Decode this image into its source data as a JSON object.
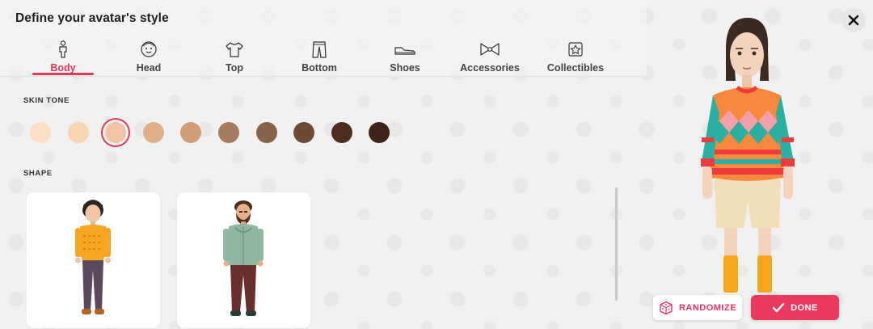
{
  "title": "Define your avatar's style",
  "tabs": [
    {
      "label": "Body",
      "icon": "body-icon",
      "active": true
    },
    {
      "label": "Head",
      "icon": "head-icon",
      "active": false
    },
    {
      "label": "Top",
      "icon": "shirt-icon",
      "active": false
    },
    {
      "label": "Bottom",
      "icon": "pants-icon",
      "active": false
    },
    {
      "label": "Shoes",
      "icon": "shoe-icon",
      "active": false
    },
    {
      "label": "Accessories",
      "icon": "bow-icon",
      "active": false
    },
    {
      "label": "Collectibles",
      "icon": "star-box-icon",
      "active": false
    }
  ],
  "skin_tone": {
    "label": "SKIN TONE",
    "swatches": [
      "#fbe0c4",
      "#f8d5b0",
      "#efc5a5",
      "#ddb08a",
      "#cf9f78",
      "#a57c5d",
      "#88634a",
      "#6e4a35",
      "#4f2d1e",
      "#3c2418"
    ],
    "selected_index": 2
  },
  "shape": {
    "label": "SHAPE",
    "options": [
      "female-body",
      "male-body"
    ]
  },
  "buttons": {
    "randomize": "RANDOMIZE",
    "done": "DONE"
  },
  "colors": {
    "accent": "#e6365a"
  }
}
